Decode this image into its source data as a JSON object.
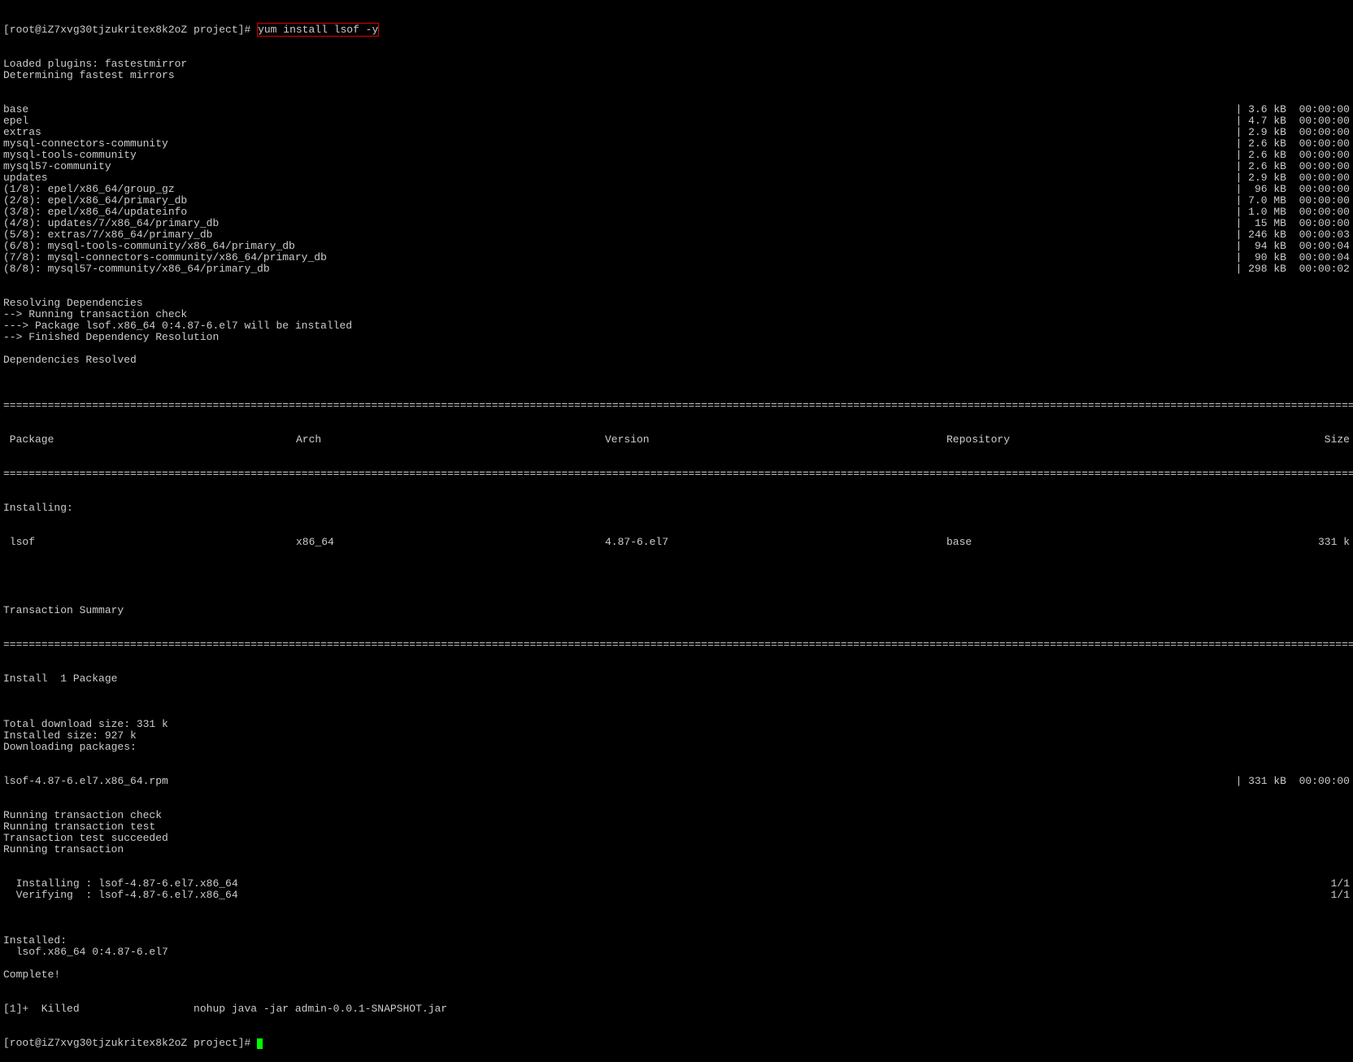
{
  "prompt1_prefix": "[root@iZ7xvg30tjzukritex8k2oZ project]# ",
  "command": "yum install lsof -y",
  "lines_pre": [
    "Loaded plugins: fastestmirror",
    "Determining fastest mirrors"
  ],
  "repos": [
    {
      "l": "base",
      "r": "| 3.6 kB  00:00:00"
    },
    {
      "l": "epel",
      "r": "| 4.7 kB  00:00:00"
    },
    {
      "l": "extras",
      "r": "| 2.9 kB  00:00:00"
    },
    {
      "l": "mysql-connectors-community",
      "r": "| 2.6 kB  00:00:00"
    },
    {
      "l": "mysql-tools-community",
      "r": "| 2.6 kB  00:00:00"
    },
    {
      "l": "mysql57-community",
      "r": "| 2.6 kB  00:00:00"
    },
    {
      "l": "updates",
      "r": "| 2.9 kB  00:00:00"
    },
    {
      "l": "(1/8): epel/x86_64/group_gz",
      "r": "|  96 kB  00:00:00"
    },
    {
      "l": "(2/8): epel/x86_64/primary_db",
      "r": "| 7.0 MB  00:00:00"
    },
    {
      "l": "(3/8): epel/x86_64/updateinfo",
      "r": "| 1.0 MB  00:00:00"
    },
    {
      "l": "(4/8): updates/7/x86_64/primary_db",
      "r": "|  15 MB  00:00:00"
    },
    {
      "l": "(5/8): extras/7/x86_64/primary_db",
      "r": "| 246 kB  00:00:03"
    },
    {
      "l": "(6/8): mysql-tools-community/x86_64/primary_db",
      "r": "|  94 kB  00:00:04"
    },
    {
      "l": "(7/8): mysql-connectors-community/x86_64/primary_db",
      "r": "|  90 kB  00:00:04"
    },
    {
      "l": "(8/8): mysql57-community/x86_64/primary_db",
      "r": "| 298 kB  00:00:02"
    }
  ],
  "resolve": [
    "Resolving Dependencies",
    "--> Running transaction check",
    "---> Package lsof.x86_64 0:4.87-6.el7 will be installed",
    "--> Finished Dependency Resolution",
    "",
    "Dependencies Resolved",
    ""
  ],
  "divider": "================================================================================================================================================================================================================================================",
  "headers": {
    "c1": " Package",
    "c2": "Arch",
    "c3": "Version",
    "c4": "Repository",
    "c5": "Size"
  },
  "installing_label": "Installing:",
  "pkg_row": {
    "c1": " lsof",
    "c2": "x86_64",
    "c3": "4.87-6.el7",
    "c4": "base",
    "c5": "331 k"
  },
  "txn_summary": "Transaction Summary",
  "install_count": "Install  1 Package",
  "post": [
    "",
    "Total download size: 331 k",
    "Installed size: 927 k",
    "Downloading packages:"
  ],
  "download_row": {
    "l": "lsof-4.87-6.el7.x86_64.rpm",
    "r": "| 331 kB  00:00:00"
  },
  "txn_run": [
    "Running transaction check",
    "Running transaction test",
    "Transaction test succeeded",
    "Running transaction"
  ],
  "install_rows": [
    {
      "l": "  Installing : lsof-4.87-6.el7.x86_64",
      "r": "1/1"
    },
    {
      "l": "  Verifying  : lsof-4.87-6.el7.x86_64",
      "r": "1/1"
    }
  ],
  "installed": [
    "",
    "Installed:",
    "  lsof.x86_64 0:4.87-6.el7",
    "",
    "Complete!"
  ],
  "killed_line": "[1]+  Killed                  nohup java -jar admin-0.0.1-SNAPSHOT.jar",
  "prompt2": "[root@iZ7xvg30tjzukritex8k2oZ project]# "
}
